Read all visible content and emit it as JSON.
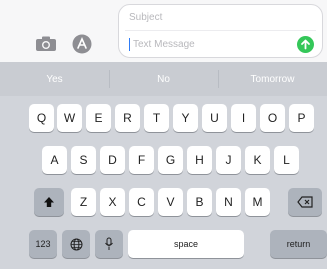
{
  "compose": {
    "subject_placeholder": "Subject",
    "message_placeholder": "Text Message"
  },
  "suggestions": [
    "Yes",
    "No",
    "Tomorrow"
  ],
  "keyboard": {
    "row1": [
      "Q",
      "W",
      "E",
      "R",
      "T",
      "Y",
      "U",
      "I",
      "O",
      "P"
    ],
    "row2": [
      "A",
      "S",
      "D",
      "F",
      "G",
      "H",
      "J",
      "K",
      "L"
    ],
    "row3": [
      "Z",
      "X",
      "C",
      "V",
      "B",
      "N",
      "M"
    ],
    "numbers_label": "123",
    "space_label": "space",
    "return_label": "return"
  },
  "colors": {
    "send": "#34c759",
    "caret": "#2f7cf6"
  }
}
